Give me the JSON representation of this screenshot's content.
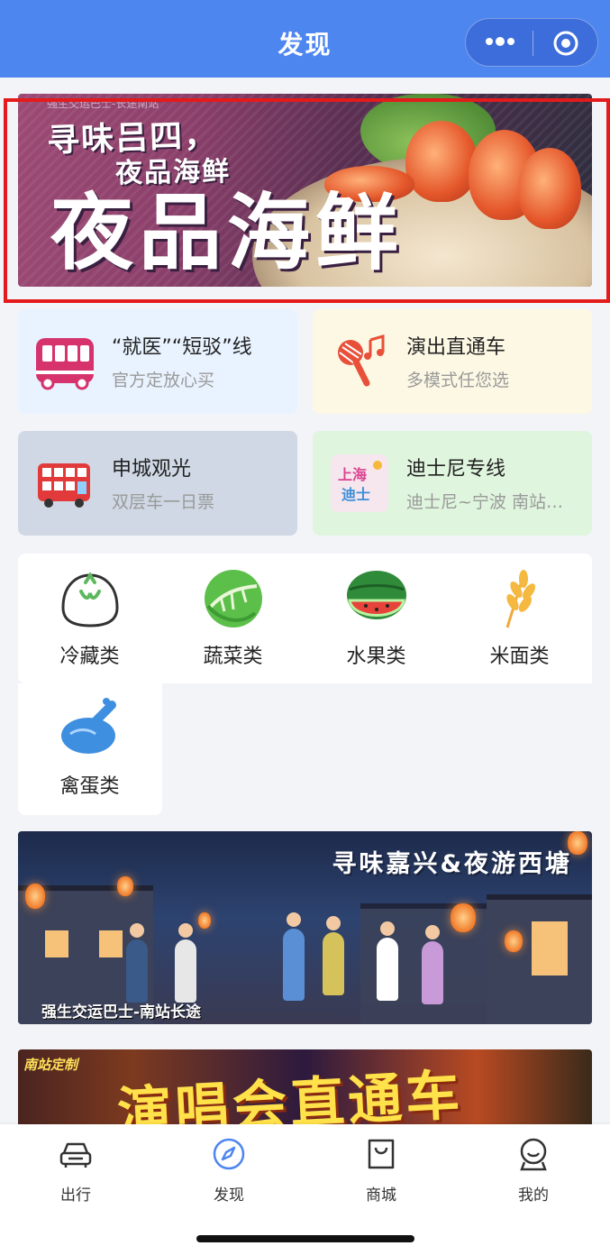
{
  "header": {
    "title": "发现"
  },
  "banner_top": {
    "small_text": "强生交运巴士-长途南站",
    "subtitle_line1": "寻味吕四，",
    "subtitle_line2": "夜品海鲜",
    "headline": "夜品海鲜"
  },
  "cards": [
    {
      "title": "“就医”“短驳”线",
      "desc": "官方定放心买",
      "icon": "bus-icon"
    },
    {
      "title": "演出直通车",
      "desc": "多模式任您选",
      "icon": "microphone-icon"
    },
    {
      "title": "申城观光",
      "desc": "双层车一日票",
      "icon": "double-decker-bus-icon"
    },
    {
      "title": "迪士尼专线",
      "desc": "迪士尼~宁波 南站…",
      "icon": "disney-sticker-icon"
    }
  ],
  "categories": [
    {
      "label": "冷藏类",
      "icon": "steamed-bun-icon"
    },
    {
      "label": "蔬菜类",
      "icon": "cabbage-icon"
    },
    {
      "label": "水果类",
      "icon": "watermelon-icon"
    },
    {
      "label": "米面类",
      "icon": "wheat-icon"
    },
    {
      "label": "禽蛋类",
      "icon": "roast-chicken-icon"
    }
  ],
  "banner_middle": {
    "title": "寻味嘉兴&夜游西塘",
    "footer": "强生交运巴士-南站长途"
  },
  "banner_bottom": {
    "tag": "南站定制",
    "title": "演唱会直通车"
  },
  "tabbar": [
    {
      "label": "出行",
      "icon": "car-icon"
    },
    {
      "label": "发现",
      "icon": "compass-icon",
      "active": true
    },
    {
      "label": "商城",
      "icon": "shopping-bag-icon"
    },
    {
      "label": "我的",
      "icon": "profile-icon"
    }
  ],
  "colors": {
    "header": "#4e86f0",
    "highlight_frame": "#e41b1b"
  }
}
